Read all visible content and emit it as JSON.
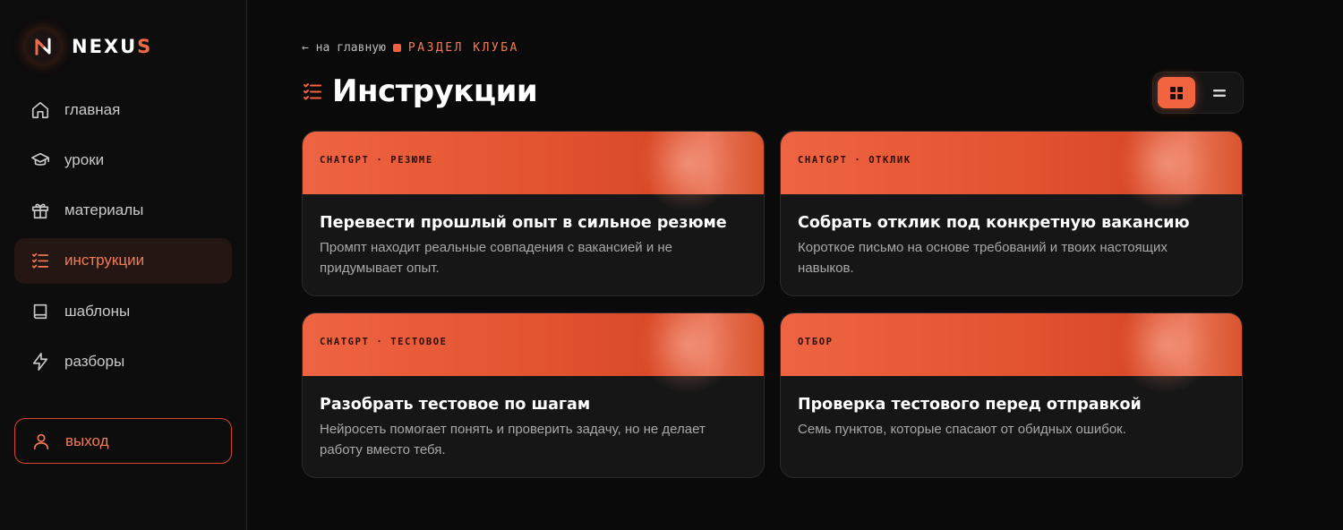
{
  "brand": {
    "name_main": "NEXU",
    "name_accent": "S"
  },
  "sidebar": {
    "items": [
      {
        "label": "главная",
        "icon": "home-icon"
      },
      {
        "label": "уроки",
        "icon": "graduation-cap-icon"
      },
      {
        "label": "материалы",
        "icon": "gift-icon"
      },
      {
        "label": "инструкции",
        "icon": "list-check-icon",
        "active": true
      },
      {
        "label": "шаблоны",
        "icon": "book-icon"
      },
      {
        "label": "разборы",
        "icon": "lightning-icon"
      }
    ],
    "logout_label": "выход"
  },
  "breadcrumb": {
    "back": "← на главную",
    "section": "РАЗДЕЛ КЛУБА"
  },
  "page": {
    "title": "Инструкции"
  },
  "view_toggle": {
    "active": "grid"
  },
  "cards": [
    {
      "tag": "CHATGPT · РЕЗЮМЕ",
      "title": "Перевести прошлый опыт в сильное резюме",
      "desc": "Промпт находит реальные совпадения с вакансией и не придумывает опыт."
    },
    {
      "tag": "CHATGPT · ОТКЛИК",
      "title": "Собрать отклик под конкретную вакансию",
      "desc": "Короткое письмо на основе требований и твоих настоящих навыков."
    },
    {
      "tag": "CHATGPT · ТЕСТОВОЕ",
      "title": "Разобрать тестовое по шагам",
      "desc": "Нейросеть помогает понять и проверить задачу, но не делает работу вместо тебя."
    },
    {
      "tag": "ОТБОР",
      "title": "Проверка тестового перед отправкой",
      "desc": "Семь пунктов, которые спасают от обидных ошибок."
    }
  ],
  "colors": {
    "accent": "#f2643f",
    "background": "#0a0a0a",
    "card": "#161616"
  }
}
